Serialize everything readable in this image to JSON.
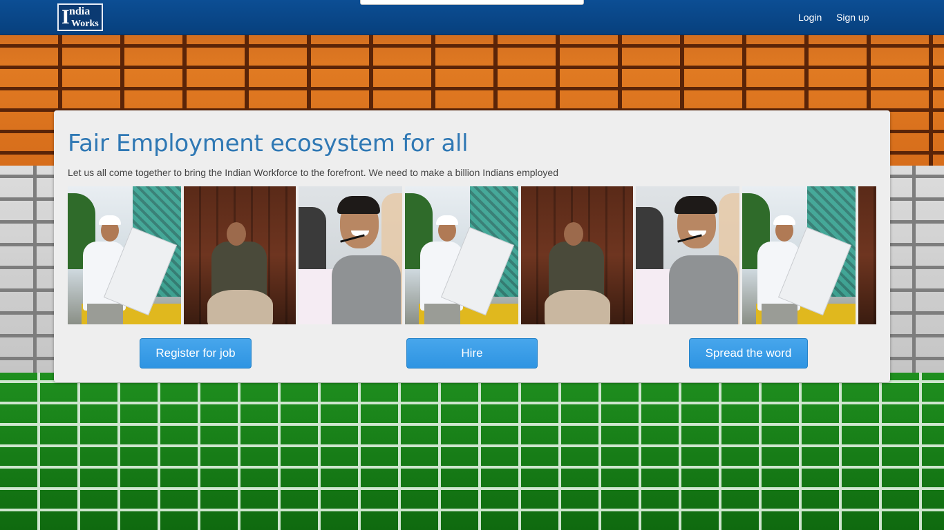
{
  "nav": {
    "logo": {
      "line1": "ndia",
      "line2": "Works",
      "initial": "I"
    },
    "login_label": "Login",
    "signup_label": "Sign up"
  },
  "hero": {
    "title": "Fair Employment ecosystem for all",
    "subtitle": "Let us all come together to bring the Indian Workforce to the forefront. We need to make a billion Indians employed"
  },
  "photos": [
    "engineer",
    "potter",
    "call-center-agent",
    "engineer",
    "potter",
    "call-center-agent",
    "engineer",
    "potter"
  ],
  "buttons": {
    "register_label": "Register for job",
    "hire_label": "Hire",
    "spread_label": "Spread the word"
  },
  "colors": {
    "navbar": "#0c4e94",
    "title": "#2f78b4",
    "button": "#3a9de6",
    "panel": "#eeeeee"
  }
}
